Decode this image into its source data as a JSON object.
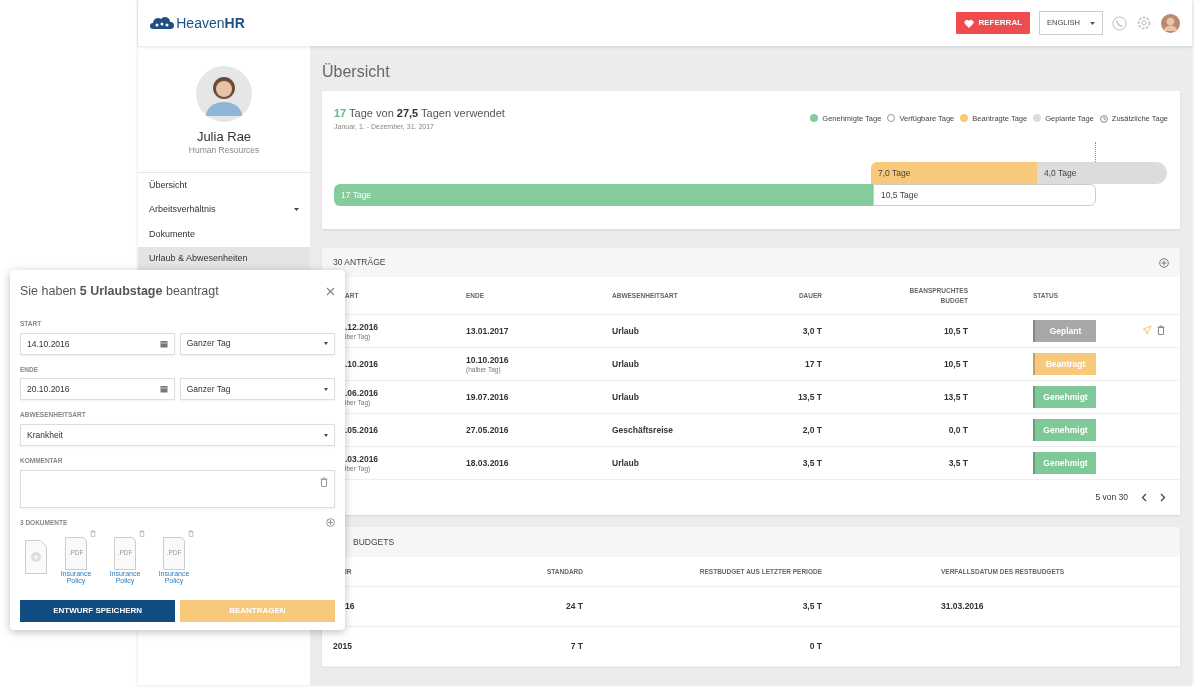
{
  "header": {
    "logo": "Heaven**HR**",
    "referral": "REFERRAL",
    "language": "ENGLISH"
  },
  "profile": {
    "name": "Julia Rae",
    "role": "Human Resources"
  },
  "sidebar": {
    "items": [
      {
        "label": "Übersicht",
        "selected": false,
        "expandable": false
      },
      {
        "label": "Arbeitsverhältnis",
        "selected": false,
        "expandable": true
      },
      {
        "label": "Dokumente",
        "selected": false,
        "expandable": false
      },
      {
        "label": "Urlaub & Abwesenheiten",
        "selected": true,
        "expandable": false
      }
    ]
  },
  "page_title": "Übersicht",
  "overview": {
    "used": "17",
    "used_text": "Tage von",
    "total": "27,5",
    "total_text": "Tagen verwendet",
    "period": "Januar, 1. - Dezember, 31.  2017",
    "legend": [
      {
        "label": "Genehmigte Tage",
        "kind": "dot",
        "color": "#84cc9c"
      },
      {
        "label": "Verfügbare Tage",
        "kind": "ring",
        "color": "#ffffff"
      },
      {
        "label": "Beantragte Tage",
        "kind": "dot",
        "color": "#f8c97a"
      },
      {
        "label": "Geplante Tage",
        "kind": "dot",
        "color": "#dddddd"
      },
      {
        "label": "Zusätzliche Tage",
        "kind": "clock"
      }
    ],
    "bar_top": [
      {
        "label": "7,0 Tage",
        "color": "#f8c97a"
      },
      {
        "label": "4,0 Tage",
        "color": "#dcdcdc"
      }
    ],
    "bar_bottom": [
      {
        "label": "17 Tage",
        "color": "#84cc9c"
      },
      {
        "label": "10,5 Tage",
        "color": "#ffffff"
      }
    ]
  },
  "requests": {
    "title": "30 ANTRÄGE",
    "columns": [
      "ART",
      "ENDE",
      "ABWESENHEITSART",
      "DAUER",
      "BEANSPRUCHTES BUDGET",
      "STATUS"
    ],
    "rows": [
      {
        "start": ".12.2016",
        "start_note": "lber Tag)",
        "end": "13.01.2017",
        "type": "Urlaub",
        "duration": "3,0 T",
        "budget": "10,5 T",
        "status": "Geplant",
        "color": "#a8a8a8",
        "actions": true
      },
      {
        "start": ".10.2016",
        "end": "10.10.2016",
        "end_note": "(halber Tag)",
        "type": "Urlaub",
        "duration": "17 T",
        "budget": "10,5 T",
        "status": "Beantragt",
        "color": "#f8c97a",
        "actions": false
      },
      {
        "start": ".06.2016",
        "start_note": "lber Tag)",
        "end": "19.07.2016",
        "type": "Urlaub",
        "duration": "13,5 T",
        "budget": "13,5 T",
        "status": "Genehmigt",
        "color": "#7fc999",
        "actions": false
      },
      {
        "start": ".05.2016",
        "end": "27.05.2016",
        "type": "Geschäftsreise",
        "duration": "2,0 T",
        "budget": "0,0 T",
        "status": "Genehmigt",
        "color": "#7fc999",
        "actions": false
      },
      {
        "start": ".03.2016",
        "start_note": "lber Tag)",
        "end": "18.03.2016",
        "type": "Urlaub",
        "duration": "3,5 T",
        "budget": "3,5 T",
        "status": "Genehmigt",
        "color": "#7fc999",
        "actions": false
      }
    ],
    "pagination": "5 von 30"
  },
  "budgets": {
    "title": "BUDGETS",
    "columns": [
      "IR",
      "STANDARD",
      "RESTBUDGET AUS LETZTER PERIODE",
      "VERFALLSDATUM DES RESTBUDGETS"
    ],
    "rows": [
      [
        "16",
        "24 T",
        "3,5 T",
        "31.03.2016"
      ],
      [
        "2015",
        "7 T",
        "0 T"
      ]
    ]
  },
  "dialog": {
    "title": "Sie haben **5 Urlaubstage** beantragt",
    "start_label": "START",
    "start_value": "14.10.2016",
    "start_day": "Ganzer Tag",
    "end_label": "ENDE",
    "end_value": "20.10.2016",
    "end_day": "Ganzer Tag",
    "type_label": "ABWESENHEITSART",
    "type_value": "Krankheit",
    "comment_label": "KOMMENTAR",
    "docs_label": "3 DOKUMENTE",
    "docs": [
      {
        "ext": ".PDF",
        "name": "Insurance Policy"
      },
      {
        "ext": ".PDF",
        "name": "Insurance Policy"
      },
      {
        "ext": ".PDF",
        "name": "Insurance Policy"
      }
    ],
    "save": "ENTWURF SPEICHERN",
    "submit": "BEANTRAGEN"
  }
}
